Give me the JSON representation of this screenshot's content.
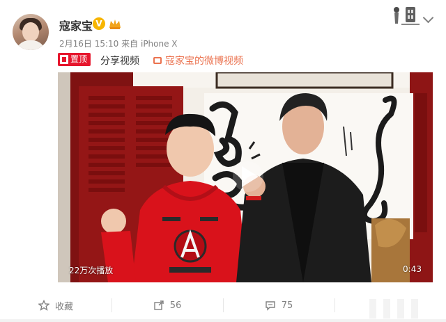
{
  "post": {
    "author": "寇家宝",
    "verified_badge": "V",
    "date_time": "2月16日 15:10",
    "source_prefix": "来自",
    "device": "iPhone X",
    "pinned_label": "置顶",
    "body_text": "分享视频",
    "video_link_label": "寇家宝的微博视频"
  },
  "video": {
    "play_count": "22万次播放",
    "duration": "0:43"
  },
  "actions": [
    {
      "label": "收藏",
      "icon": "star-outline-icon"
    },
    {
      "label": "56",
      "icon": "share-icon"
    },
    {
      "label": "75",
      "icon": "comment-icon"
    }
  ],
  "colors": {
    "accent_red": "#e6162d",
    "link_orange": "#eb7350",
    "verified_gold": "#f7b500",
    "meta_gray": "#808080"
  }
}
